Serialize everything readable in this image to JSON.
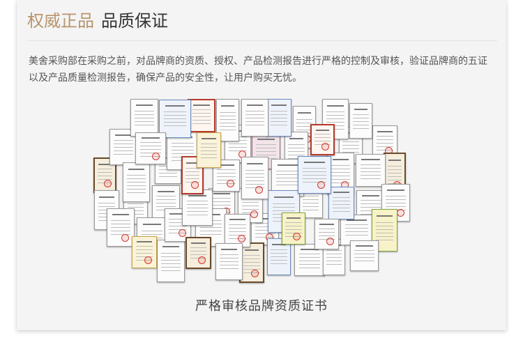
{
  "header": {
    "title_accent": "权威正品",
    "title_main": "品质保证"
  },
  "description": "美舍采购部在采购之前，对品牌商的资质、授权、产品检测报告进行严格的控制及审核，验证品牌商的五证以及产品质量检测报告，确保产品的安全性，让用户购买无忧。",
  "collage": {
    "caption": "严格审核品牌资质证书"
  },
  "colors": {
    "accent": "#b8946b",
    "title": "#333333",
    "text": "#555555",
    "card_bg": "#f4f4f4"
  }
}
